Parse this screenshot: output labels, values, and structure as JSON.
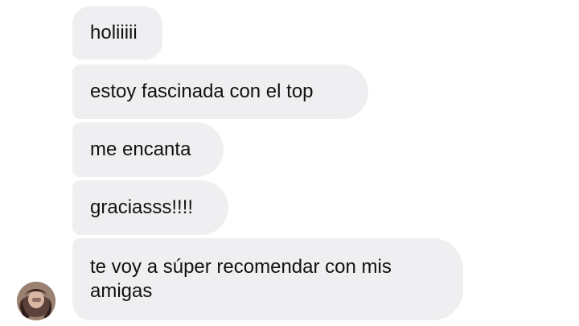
{
  "messages": [
    {
      "text": "holiiiii"
    },
    {
      "text": "estoy fascinada con el top"
    },
    {
      "text": "me encanta"
    },
    {
      "text": "graciasss!!!!"
    },
    {
      "text": "te voy a súper recomendar con mis amigas"
    }
  ],
  "avatar": {
    "icon": "profile-photo",
    "bubble_color": "#efeff1"
  }
}
